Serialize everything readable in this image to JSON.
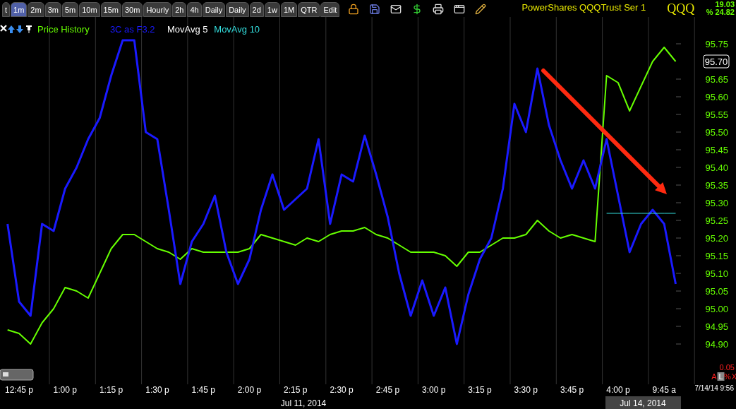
{
  "toolbar": {
    "tabs": [
      {
        "label": "t",
        "selected": false
      },
      {
        "label": "1m",
        "selected": true
      },
      {
        "label": "2m",
        "selected": false
      },
      {
        "label": "3m",
        "selected": false
      },
      {
        "label": "5m",
        "selected": false
      },
      {
        "label": "10m",
        "selected": false
      },
      {
        "label": "15m",
        "selected": false
      },
      {
        "label": "30m",
        "selected": false
      },
      {
        "label": "Hourly",
        "selected": false
      },
      {
        "label": "2h",
        "selected": false
      },
      {
        "label": "4h",
        "selected": false
      },
      {
        "label": "Daily",
        "selected": false
      },
      {
        "label": "Daily",
        "selected": false
      },
      {
        "label": "2d",
        "selected": false
      },
      {
        "label": "1w",
        "selected": false
      },
      {
        "label": "1M",
        "selected": false
      },
      {
        "label": "QTR",
        "selected": false
      },
      {
        "label": "Edit",
        "selected": false
      }
    ],
    "title": "PowerShares QQQTrust Ser 1",
    "symbol": "QQQ",
    "change": "19.03",
    "change_pct": "% 24.82"
  },
  "chart": {
    "last_price": "95.70",
    "chart_data": {
      "type": "line",
      "ylim": [
        94.79,
        95.826
      ],
      "categories": [
        null,
        "12:45 p",
        null,
        null,
        null,
        "1:00 p",
        null,
        null,
        null,
        "1:15 p",
        null,
        null,
        null,
        "1:30 p",
        null,
        null,
        null,
        "1:45 p",
        null,
        null,
        null,
        "2:00 p",
        null,
        null,
        null,
        "2:15 p",
        null,
        null,
        null,
        "2:30 p",
        null,
        null,
        null,
        "2:45 p",
        null,
        null,
        null,
        "3:00 p",
        null,
        null,
        null,
        "3:15 p",
        null,
        null,
        null,
        "3:30 p",
        null,
        null,
        null,
        "3:45 p",
        null,
        null,
        null,
        "4:00 p",
        null,
        null,
        null,
        "9:45 a",
        null
      ],
      "series": [
        {
          "name": "Price History",
          "color": "#66ff00",
          "values": [
            94.94,
            94.93,
            94.9,
            94.96,
            95.0,
            95.06,
            95.05,
            95.03,
            95.1,
            95.17,
            95.21,
            95.21,
            95.19,
            95.17,
            95.16,
            95.14,
            95.17,
            95.16,
            95.16,
            95.16,
            95.16,
            95.17,
            95.21,
            95.2,
            95.19,
            95.18,
            95.2,
            95.19,
            95.21,
            95.22,
            95.22,
            95.23,
            95.21,
            95.2,
            95.18,
            95.16,
            95.16,
            95.16,
            95.15,
            95.12,
            95.16,
            95.16,
            95.18,
            95.2,
            95.2,
            95.21,
            95.25,
            95.22,
            95.2,
            95.21,
            95.2,
            95.19,
            95.66,
            95.64,
            95.56,
            95.63,
            95.7,
            95.74,
            95.7
          ]
        },
        {
          "name": "3C as F3.2",
          "color": "#1a1aff",
          "values": [
            95.24,
            95.02,
            94.98,
            95.24,
            95.22,
            95.34,
            95.4,
            95.48,
            95.54,
            95.66,
            95.76,
            95.76,
            95.5,
            95.48,
            95.28,
            95.07,
            95.19,
            95.24,
            95.32,
            95.16,
            95.07,
            95.14,
            95.28,
            95.38,
            95.28,
            95.31,
            95.34,
            95.48,
            95.24,
            95.38,
            95.36,
            95.49,
            95.38,
            95.26,
            95.1,
            94.98,
            95.08,
            94.98,
            95.06,
            94.9,
            95.04,
            95.14,
            95.2,
            95.34,
            95.58,
            95.5,
            95.68,
            95.52,
            95.42,
            95.34,
            95.42,
            95.34,
            95.48,
            95.32,
            95.16,
            95.24,
            95.28,
            95.24,
            95.07
          ]
        },
        {
          "name": "MovAvg 5",
          "color": "#ffffff",
          "values": [
            null,
            null,
            null,
            null,
            null,
            null,
            null,
            null,
            null,
            null,
            null,
            null,
            null,
            null,
            null,
            null,
            null,
            null,
            null,
            null,
            null,
            null,
            null,
            null,
            null,
            null,
            null,
            null,
            null,
            null,
            null,
            null,
            null,
            null,
            null,
            null,
            null,
            null,
            null,
            null,
            null,
            null,
            null,
            null,
            null,
            null,
            null,
            null,
            null,
            null,
            null,
            null,
            null,
            null,
            null,
            null,
            null,
            null,
            null
          ]
        },
        {
          "name": "MovAvg 10",
          "color": "#33dddd",
          "values": [
            null,
            null,
            null,
            null,
            null,
            null,
            null,
            null,
            null,
            null,
            null,
            null,
            null,
            null,
            null,
            null,
            null,
            null,
            null,
            null,
            null,
            null,
            null,
            null,
            null,
            null,
            null,
            null,
            null,
            null,
            null,
            null,
            null,
            null,
            null,
            null,
            null,
            null,
            null,
            null,
            null,
            null,
            null,
            null,
            null,
            null,
            null,
            null,
            null,
            null,
            null,
            null,
            95.27,
            95.27,
            95.27,
            95.27,
            95.27,
            95.27,
            95.27
          ]
        }
      ],
      "yticks": [
        {
          "value": 94.9,
          "label": "94.90"
        },
        {
          "value": 94.95,
          "label": "94.95"
        },
        {
          "value": 95.0,
          "label": "95.00"
        },
        {
          "value": 95.05,
          "label": "95.05"
        },
        {
          "value": 95.1,
          "label": "95.10"
        },
        {
          "value": 95.15,
          "label": "95.15"
        },
        {
          "value": 95.2,
          "label": "95.20"
        },
        {
          "value": 95.25,
          "label": "95.25"
        },
        {
          "value": 95.3,
          "label": "95.30"
        },
        {
          "value": 95.35,
          "label": "95.35"
        },
        {
          "value": 95.4,
          "label": "95.40"
        },
        {
          "value": 95.45,
          "label": "95.45"
        },
        {
          "value": 95.5,
          "label": "95.50"
        },
        {
          "value": 95.55,
          "label": "95.55"
        },
        {
          "value": 95.6,
          "label": "95.60"
        },
        {
          "value": 95.65,
          "label": "95.65"
        },
        {
          "value": 95.75,
          "label": "95.75"
        }
      ]
    }
  },
  "scale_controls": {
    "step": "0.05",
    "buttons": [
      {
        "label": "A",
        "selected": false
      },
      {
        "label": "L",
        "selected": true
      },
      {
        "label": "%",
        "selected": false
      },
      {
        "label": "X",
        "selected": false
      }
    ]
  },
  "timestamp": "7/14/14 9:56",
  "dates": [
    {
      "label": "Jul 11, 2014",
      "selected": false
    },
    {
      "label": "Jul 14, 2014",
      "selected": true
    }
  ]
}
